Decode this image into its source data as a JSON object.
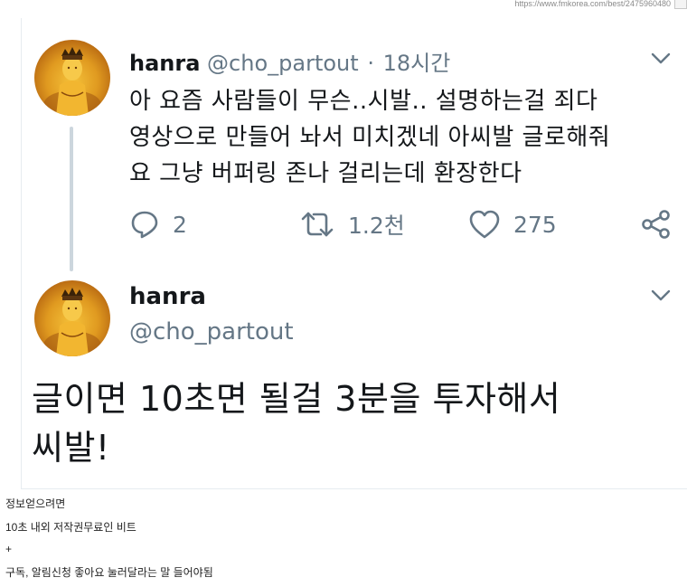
{
  "browser": {
    "url": "https://www.fmkorea.com/best/2475960480"
  },
  "tweet1": {
    "display_name": "hanra",
    "handle": "@cho_partout",
    "separator": "·",
    "time": "18시간",
    "lines": [
      "아 요즘 사람들이 무슨..시발.. 설명하는걸 죄다",
      "영상으로 만들어 놔서 미치겠네 아씨발 글로해줘",
      "요 그냥 버퍼링 존나 걸리는데 환장한다"
    ],
    "actions": {
      "reply_count": "2",
      "retweet_count": "1.2천",
      "like_count": "275"
    }
  },
  "tweet2": {
    "display_name": "hanra",
    "handle": "@cho_partout",
    "lines": [
      "글이면 10초면 될걸 3분을 투자해서",
      "씨발!"
    ]
  },
  "caption": {
    "lines": [
      "정보얻으려면",
      "10초 내외 저작권무료인 비트",
      "+",
      "구독, 알림신청 좋아요 눌러달라는 말 들어야됨"
    ]
  },
  "colors": {
    "text": "#14171a",
    "secondary": "#657786",
    "thread_line": "#ccd6dd",
    "avatar_gold": "#e09a20"
  },
  "icons": [
    "reply-icon",
    "retweet-icon",
    "like-icon",
    "share-icon",
    "chevron-down-icon"
  ]
}
